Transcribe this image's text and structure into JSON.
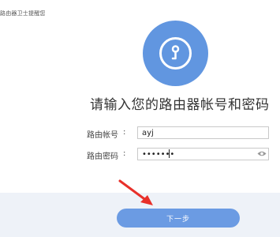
{
  "header": {
    "text": "路由器卫士提醒您"
  },
  "hero": {
    "icon": "lock-icon",
    "headline": "请输入您的路由器帐号和密码"
  },
  "form": {
    "account_label": "路由帐号",
    "account_colon": ":",
    "account_value": "ayj",
    "password_label": "路由密码",
    "password_colon": ":",
    "password_value": "•••••••",
    "password_icon": "eye-icon"
  },
  "footer": {
    "next_label": "下一步"
  },
  "colors": {
    "accent": "#6196e0",
    "button": "#6b9be3",
    "footer_bg": "#eef2f8",
    "arrow": "#e8302a"
  }
}
